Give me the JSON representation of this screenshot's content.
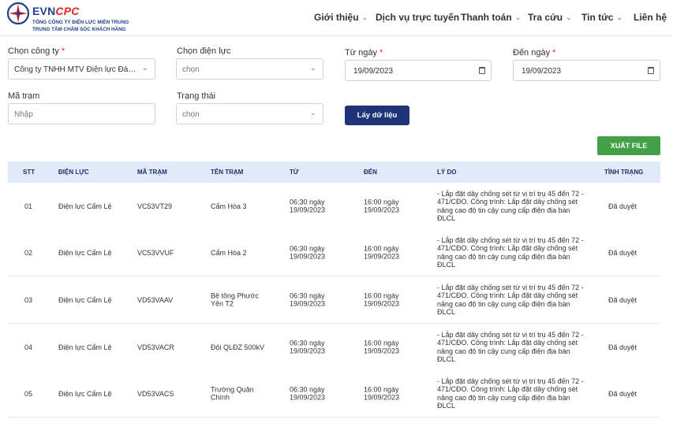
{
  "brand": {
    "name_part1": "EVN",
    "name_part2": "CPC",
    "subtitle_line1": "TỔNG CÔNG TY ĐIỆN LỰC MIỀN TRUNG",
    "subtitle_line2": "TRUNG TÂM CHĂM SÓC KHÁCH HÀNG"
  },
  "nav": [
    {
      "label": "Giới thiệu",
      "has_dropdown": true
    },
    {
      "label": "Dịch vụ trực tuyến",
      "has_dropdown": false
    },
    {
      "label": "Thanh toán",
      "has_dropdown": true
    },
    {
      "label": "Tra cứu",
      "has_dropdown": true
    },
    {
      "label": "Tin tức",
      "has_dropdown": true
    },
    {
      "label": "Liên hệ",
      "has_dropdown": false
    }
  ],
  "form": {
    "company": {
      "label": "Chọn công ty",
      "required": "*",
      "value": "Công ty TNHH MTV Điện lực Đà Nẵng"
    },
    "power_unit": {
      "label": "Chọn điện lực",
      "placeholder": "chọn"
    },
    "from_date": {
      "label": "Từ ngày",
      "required": "*",
      "value": "19/09/2023"
    },
    "to_date": {
      "label": "Đến ngày",
      "required": "*",
      "value": "19/09/2023"
    },
    "station_code": {
      "label": "Mã trạm",
      "placeholder": "Nhập"
    },
    "status": {
      "label": "Trạng thái",
      "placeholder": "chọn"
    },
    "get_data_button": "Lấy dữ liệu",
    "export_button": "XUẤT FILE"
  },
  "table": {
    "columns": [
      "STT",
      "ĐIỆN LỰC",
      "MÃ TRẠM",
      "TÊN TRẠM",
      "TỪ",
      "ĐẾN",
      "LÝ DO",
      "TÌNH TRẠNG"
    ],
    "rows": [
      {
        "stt": "01",
        "unit": "Điện lực Cẩm Lệ",
        "code": "VC53VT29",
        "name": "Cẩm Hòa 3",
        "from": "06:30 ngày 19/09/2023",
        "to": "16:00 ngày 19/09/2023",
        "reason": "- Lắp đặt dây chống sét từ vị trí trụ 45 đến 72 - 471/CĐO. Công trình: Lắp đặt dây chống sét nâng cao độ tin cậy cung cấp điện địa bàn ĐLCL",
        "status": "Đã duyệt"
      },
      {
        "stt": "02",
        "unit": "Điện lực Cẩm Lệ",
        "code": "VC53VVUF",
        "name": "Cẩm Hòa 2",
        "from": "06:30 ngày 19/09/2023",
        "to": "16:00 ngày 19/09/2023",
        "reason": "- Lắp đặt dây chống sét từ vị trí trụ 45 đến 72 - 471/CĐO. Công trình: Lắp đặt dây chống sét nâng cao độ tin cậy cung cấp điện địa bàn ĐLCL",
        "status": "Đã duyệt"
      },
      {
        "stt": "03",
        "unit": "Điện lực Cẩm Lệ",
        "code": "VD53VAAV",
        "name": "Bê tông Phước Yên T2",
        "from": "06:30 ngày 19/09/2023",
        "to": "16:00 ngày 19/09/2023",
        "reason": "- Lắp đặt dây chống sét từ vị trí trụ 45 đến 72 - 471/CĐO. Công trình: Lắp đặt dây chống sét nâng cao độ tin cậy cung cấp điện địa bàn ĐLCL",
        "status": "Đã duyệt"
      },
      {
        "stt": "04",
        "unit": "Điện lực Cẩm Lệ",
        "code": "VD53VACR",
        "name": "Đội QLĐZ 500kV",
        "from": "06:30 ngày 19/09/2023",
        "to": "16:00 ngày 19/09/2023",
        "reason": "- Lắp đặt dây chống sét từ vị trí trụ 45 đến 72 - 471/CĐO. Công trình: Lắp đặt dây chống sét nâng cao độ tin cậy cung cấp điện địa bàn ĐLCL",
        "status": "Đã duyệt"
      },
      {
        "stt": "05",
        "unit": "Điện lực Cẩm Lệ",
        "code": "VD53VACS",
        "name": "Trường Quân Chính",
        "from": "06:30 ngày 19/09/2023",
        "to": "16:00 ngày 19/09/2023",
        "reason": "- Lắp đặt dây chống sét từ vị trí trụ 45 đến 72 - 471/CĐO. Công trình: Lắp đặt dây chống sét nâng cao độ tin cậy cung cấp điện địa bàn ĐLCL",
        "status": "Đã duyệt"
      }
    ]
  }
}
